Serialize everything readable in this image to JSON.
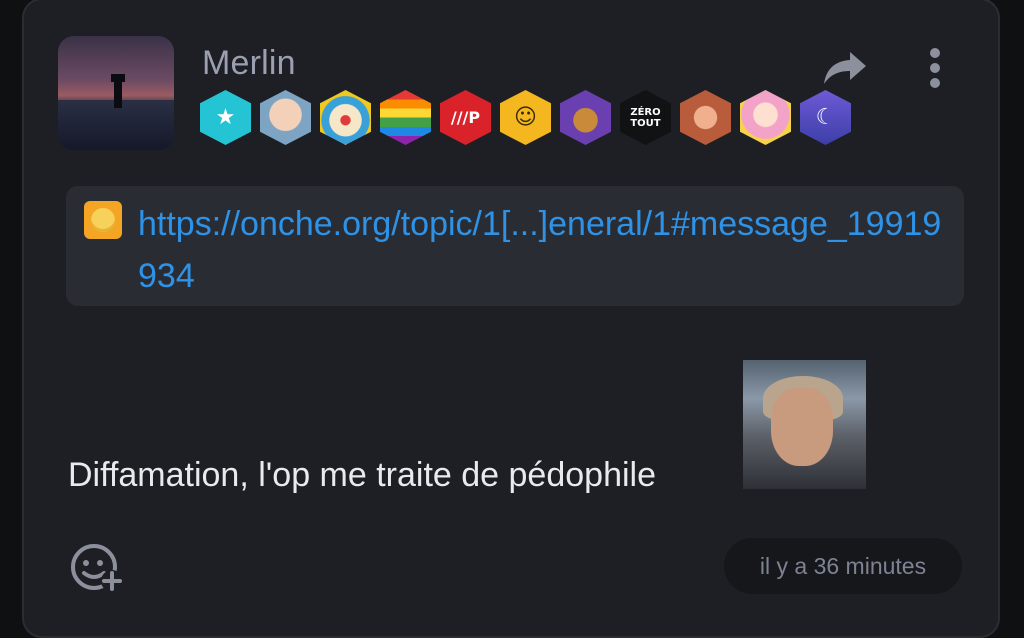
{
  "post": {
    "username": "Merlin",
    "badges": [
      {
        "icon": "stars-badge-icon",
        "text": "★"
      },
      {
        "icon": "harold-badge-icon",
        "text": ""
      },
      {
        "icon": "clown-badge-icon",
        "text": ""
      },
      {
        "icon": "rainbow-badge-icon",
        "text": ""
      },
      {
        "icon": "parking-tag-badge-icon",
        "text": "///P"
      },
      {
        "icon": "smiley-badge-icon",
        "text": "☺"
      },
      {
        "icon": "purple-character-badge-icon",
        "text": ""
      },
      {
        "icon": "zero-tout-badge-icon",
        "text": "ZÉRO TOUT"
      },
      {
        "icon": "bronze-medal-badge-icon",
        "text": ""
      },
      {
        "icon": "anime-girl-badge-icon",
        "text": ""
      },
      {
        "icon": "moon-badge-icon",
        "text": "☾"
      }
    ],
    "quoted_link": "https://onche.org/topic/1[...]eneral/1#message_19919934",
    "message": "Diffamation, l'op me traite de pédophile",
    "timestamp": "il y a 36 minutes"
  },
  "colors": {
    "background": "#1e1f24",
    "link": "#2e92e6",
    "username": "#9aa0b1",
    "text": "#e9eaee"
  }
}
